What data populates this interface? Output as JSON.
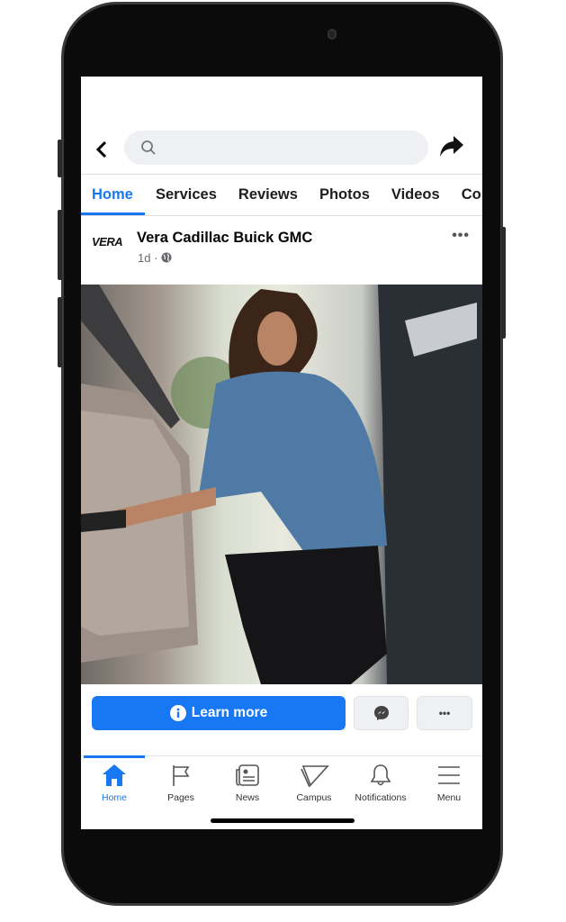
{
  "header": {
    "back_icon": "chevron-left-icon",
    "search_placeholder": "",
    "share_icon": "share-arrow-icon"
  },
  "tabs": [
    {
      "label": "Home",
      "active": true
    },
    {
      "label": "Services"
    },
    {
      "label": "Reviews"
    },
    {
      "label": "Photos"
    },
    {
      "label": "Videos"
    },
    {
      "label": "Co"
    }
  ],
  "post": {
    "logo_text": "VERA",
    "page_name": "Vera Cadillac Buick GMC",
    "time": "1d ·",
    "audience_icon": "globe-icon",
    "more_label": "•••"
  },
  "actions": {
    "learn_more": "Learn more",
    "more_label": "•••"
  },
  "bottom_nav": [
    {
      "label": "Home",
      "active": true
    },
    {
      "label": "Pages"
    },
    {
      "label": "News"
    },
    {
      "label": "Campus"
    },
    {
      "label": "Notifications"
    },
    {
      "label": "Menu"
    }
  ],
  "colors": {
    "accent": "#1877f2"
  }
}
